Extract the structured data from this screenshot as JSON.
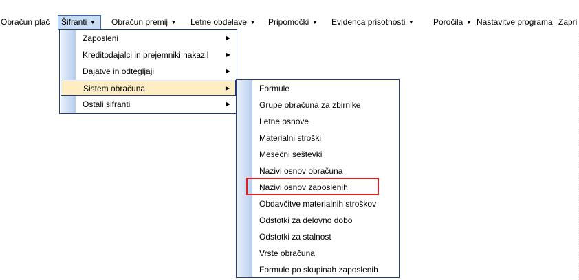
{
  "menubar": {
    "items": [
      {
        "label": "Obračun plač",
        "has_arrow": false
      },
      {
        "label": "Šifranti",
        "has_arrow": true
      },
      {
        "label": "Obračun premij",
        "has_arrow": true
      },
      {
        "label": "Letne obdelave",
        "has_arrow": true
      },
      {
        "label": "Pripomočki",
        "has_arrow": true
      },
      {
        "label": "Evidenca prisotnosti",
        "has_arrow": true
      },
      {
        "label": "Poročila",
        "has_arrow": true
      },
      {
        "label": "Nastavitve programa",
        "has_arrow": false
      },
      {
        "label": "Zapri",
        "has_arrow": false
      }
    ]
  },
  "sifranti_menu": {
    "items": [
      {
        "label": "Zaposleni",
        "has_submenu": true
      },
      {
        "label": "Kreditodajalci in prejemniki nakazil",
        "has_submenu": true
      },
      {
        "label": "Dajatve in odtegljaji",
        "has_submenu": true
      },
      {
        "label": "Sistem obračuna",
        "has_submenu": true,
        "highlighted": true
      },
      {
        "label": "Ostali šifranti",
        "has_submenu": true
      }
    ]
  },
  "sistem_obracuna_menu": {
    "items": [
      {
        "label": "Formule"
      },
      {
        "label": "Grupe obračuna za zbirnike"
      },
      {
        "label": "Letne osnove"
      },
      {
        "label": "Materialni stroški"
      },
      {
        "label": "Mesečni seštevki"
      },
      {
        "label": "Nazivi osnov obračuna"
      },
      {
        "label": "Nazivi osnov zaposlenih",
        "annotated": true
      },
      {
        "label": "Obdavčitve materialnih stroškov"
      },
      {
        "label": "Odstotki za delovno dobo"
      },
      {
        "label": "Odstotki za stalnost"
      },
      {
        "label": "Vrste obračuna"
      },
      {
        "label": "Formule po skupinah zaposlenih"
      }
    ]
  },
  "colors": {
    "annotation": "#e02020",
    "highlight": "#ffeec4",
    "border": "#1f3c80"
  }
}
